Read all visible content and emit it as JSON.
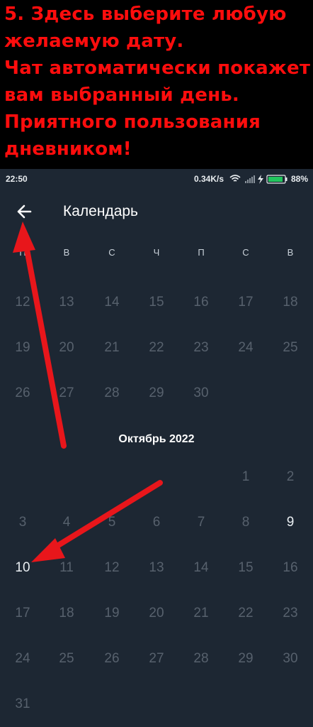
{
  "banner": {
    "lines": [
      "5. Здесь выберите любую",
      "желаемую дату.",
      "Чат автоматически покажет",
      "вам выбранный день.",
      "Приятного пользования",
      "дневником!"
    ]
  },
  "statusbar": {
    "time": "22:50",
    "speed": "0.34K/s",
    "battery": "88%"
  },
  "appbar": {
    "title": "Календарь"
  },
  "weekdays": [
    "П",
    "В",
    "С",
    "Ч",
    "П",
    "С",
    "В"
  ],
  "september_rows": [
    [
      "12",
      "13",
      "14",
      "15",
      "16",
      "17",
      "18"
    ],
    [
      "19",
      "20",
      "21",
      "22",
      "23",
      "24",
      "25"
    ],
    [
      "26",
      "27",
      "28",
      "29",
      "30"
    ]
  ],
  "october": {
    "title": "Октябрь 2022",
    "rows": [
      [
        "",
        "",
        "",
        "",
        "",
        "1",
        "2"
      ],
      [
        "3",
        "4",
        "5",
        "6",
        "7",
        "8",
        "9"
      ],
      [
        "10",
        "11",
        "12",
        "13",
        "14",
        "15",
        "16"
      ],
      [
        "17",
        "18",
        "19",
        "20",
        "21",
        "22",
        "23"
      ],
      [
        "24",
        "25",
        "26",
        "27",
        "28",
        "29",
        "30"
      ],
      [
        "31"
      ]
    ]
  },
  "colors": {
    "background": "#1d2733",
    "disabled_day": "#57616d",
    "active_day": "#e9eef2",
    "annotation": "#e8161b"
  },
  "icons": [
    "back-arrow-icon",
    "wifi-icon",
    "signal-icon",
    "charging-icon",
    "battery-icon"
  ]
}
